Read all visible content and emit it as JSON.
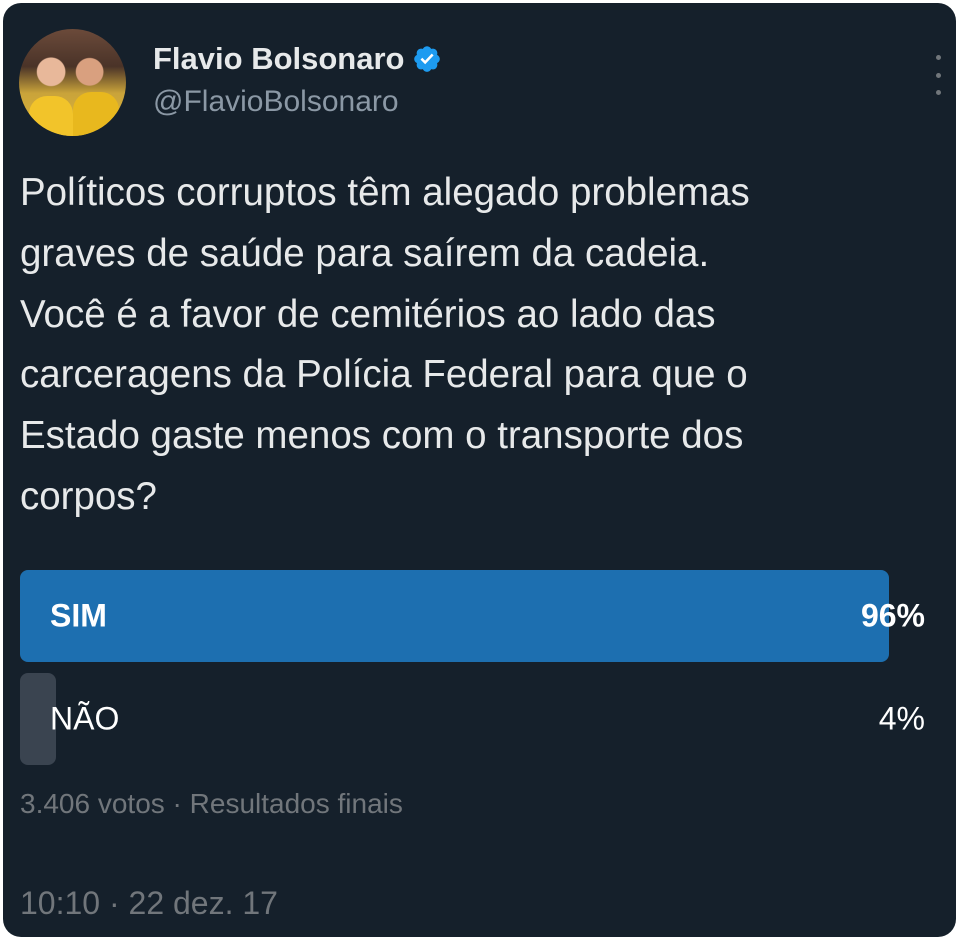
{
  "author": {
    "name": "Flavio Bolsonaro",
    "handle": "@FlavioBolsonaro",
    "verified_icon": "verified-badge-icon",
    "verified_color": "#1d9bf0"
  },
  "tweet": {
    "text": "Políticos corruptos têm alegado problemas\ngraves de saúde para saírem da cadeia.\nVocê é a favor de cemitérios ao lado das\ncarceragens da Polícia Federal para que o\nEstado gaste menos com o transporte dos\ncorpos?"
  },
  "poll": {
    "options": [
      {
        "label": "SIM",
        "percent_text": "96%",
        "percent": 96,
        "winner": true
      },
      {
        "label": "NÃO",
        "percent_text": "4%",
        "percent": 4,
        "winner": false
      }
    ],
    "meta": "3.406 votos · Resultados finais"
  },
  "timestamp": "10:10 · 22 dez. 17",
  "colors": {
    "background": "#15202b",
    "winner_bar": "#1d6fb0",
    "loser_bar": "#3a4450",
    "secondary_text": "#71767b"
  }
}
